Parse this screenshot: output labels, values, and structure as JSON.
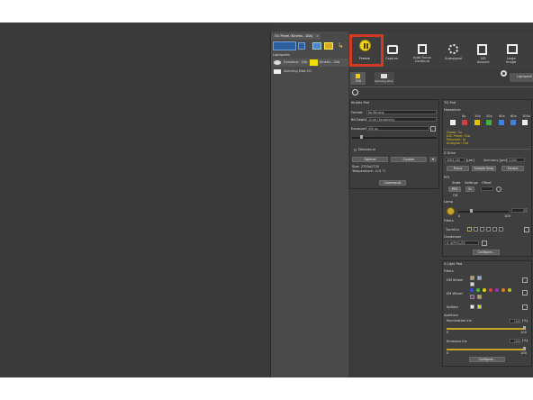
{
  "dock": {
    "tab": "OC Panel (Kinetix - DIA)",
    "close": "×",
    "header": "Lightpaths",
    "items": [
      "Eyepiece - DIA",
      "Kinetix - DIA",
      "Spinning Disk CO"
    ]
  },
  "ribbon": {
    "freeze": "Freeze",
    "capture": "Capture",
    "autofocus": "Auto Focus\nContinue",
    "autosignal": "Autosignal",
    "nd_acquire": "ND\nAcquire",
    "large_image": "Large\nImage",
    "lightpath": "Lightpath",
    "dia": "DIA",
    "spinning": "Spinning Disk"
  },
  "camera": {
    "title": "Kinetix Pad",
    "format_label": "Format",
    "format_value": "No Binning",
    "bitdepth_label": "Bit Depth",
    "bitdepth_value": "12-bit (Sensitivity)",
    "exposure_label": "Exposure",
    "exposure_value": "500 µs",
    "denoise": "Denoise.ai",
    "optimal": "Optimal",
    "custom": "Custom",
    "size": "Size: 2720x2720",
    "temperature": "Temperature: -0.0 °C",
    "commands": "Commands"
  },
  "ti2": {
    "title": "Ti2 Pad",
    "nosepiece": "Nosepiece",
    "obj_labels": [
      "4x",
      "10x",
      "20x",
      "40x",
      "60x",
      "100x"
    ],
    "zoom": "Zoom: 1x",
    "dic": "DIC Prism: Out",
    "polarizer": "Polarizer: In",
    "analyzer": "Analyzer: Out",
    "zdrive": "Z Drive",
    "z_value": "4064.240",
    "z_unit": "[µm]",
    "accuracy_label": "Accuracy [µm]",
    "accuracy": "0.000",
    "focus": "Focus",
    "sample": "Sample Snap",
    "escape": "Escape",
    "pfs": "PFS",
    "state": "State",
    "settings": "Settings",
    "offset": "Offset",
    "pfs_btn": "PFS",
    "on": "On",
    "off": "Off",
    "lamp": "Lamp",
    "lamp_min": "0",
    "lamp_max": "100",
    "lamp_val": "25",
    "filters": "Filters",
    "turret": "Turret1a",
    "condenser": "Condenser",
    "condenser_val": "0: A(PHC)/ZZ",
    "configure": "Configure..."
  },
  "light": {
    "title": "X-Light Pad",
    "filters": "Filters",
    "dm": "DM Wheel",
    "em": "EM Wheel",
    "splitter": "Splitter",
    "aperture": "Aperture",
    "ill_label": "Illumination Iris",
    "ill_val": "100",
    "ill_min": "0",
    "ill_max": "100",
    "ill_unit": "[%]",
    "em_label": "Emission Iris",
    "em_val": "100",
    "em_min": "0",
    "em_max": "100",
    "configure": "Configure..."
  }
}
